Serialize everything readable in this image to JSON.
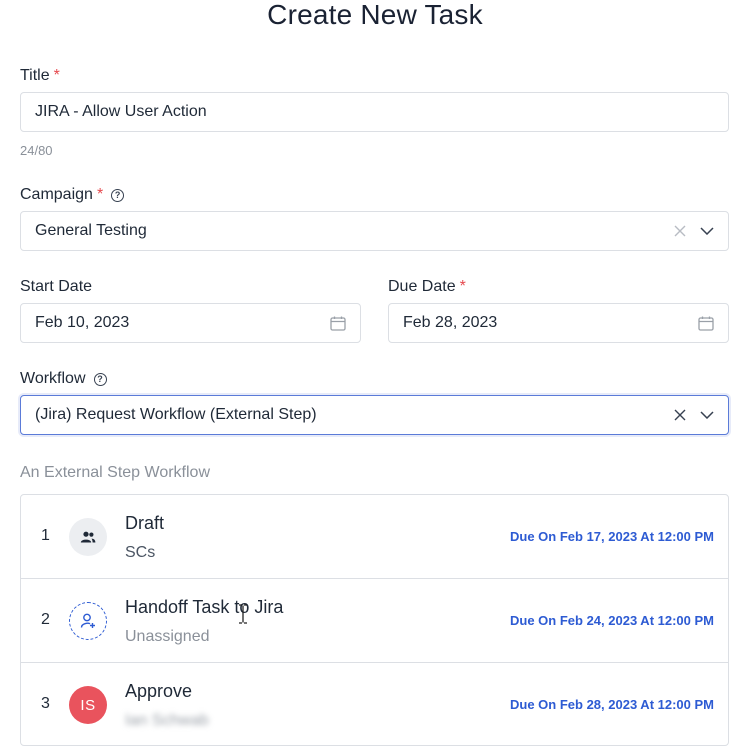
{
  "page": {
    "title": "Create New Task"
  },
  "title_field": {
    "label": "Title",
    "required_mark": "*",
    "value": "JIRA - Allow User Action",
    "counter": "24/80"
  },
  "campaign_field": {
    "label": "Campaign",
    "required_mark": "*",
    "help_icon": "?",
    "value": "General Testing"
  },
  "start_date_field": {
    "label": "Start Date",
    "value": "Feb 10, 2023"
  },
  "due_date_field": {
    "label": "Due Date",
    "required_mark": "*",
    "value": "Feb 28, 2023"
  },
  "workflow_field": {
    "label": "Workflow",
    "help_icon": "?",
    "value": "(Jira) Request Workflow (External Step)"
  },
  "workflow_description": "An External Step Workflow",
  "steps": [
    {
      "number": "1",
      "name": "Draft",
      "assignee": "SCs",
      "avatar_icon": "group-icon",
      "due": "Due On Feb 17, 2023 At 12:00 PM"
    },
    {
      "number": "2",
      "name": "Handoff Task to Jira",
      "assignee": "Unassigned",
      "avatar_icon": "add-user-icon",
      "due": "Due On Feb 24, 2023 At 12:00 PM"
    },
    {
      "number": "3",
      "name": "Approve",
      "assignee": "Ian Schwab",
      "avatar_initials": "IS",
      "due": "Due On Feb 28, 2023 At 12:00 PM"
    }
  ],
  "colors": {
    "accent": "#2d5bd3",
    "required": "#e5484d",
    "avatar_red": "#e9535d",
    "border": "#dcdfe4",
    "focus": "#5b7bd8"
  }
}
